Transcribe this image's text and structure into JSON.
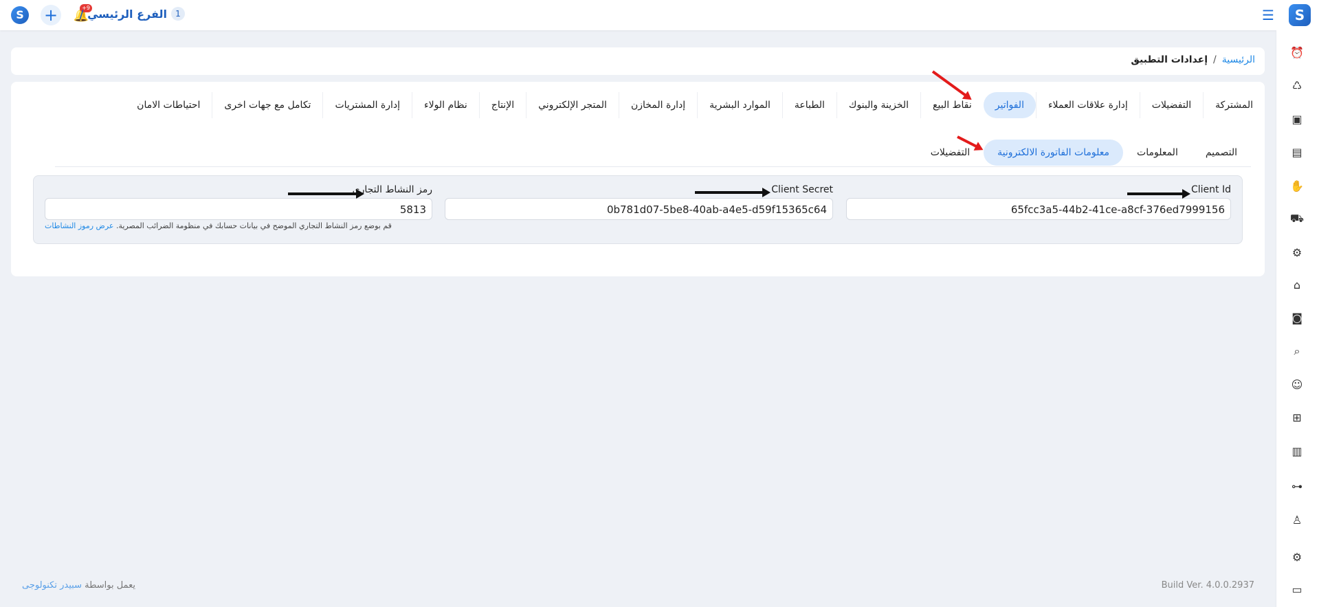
{
  "header": {
    "branch_name": "الفرع الرئيسي /",
    "branch_number": "1",
    "notifications_badge": "+9"
  },
  "breadcrumb": {
    "home": "الرئيسية",
    "separator": "/",
    "current": "إعدادات التطبيق"
  },
  "tabs": [
    {
      "label": "المشتركة"
    },
    {
      "label": "التفضيلات"
    },
    {
      "label": "إدارة علاقات العملاء"
    },
    {
      "label": "الفواتير"
    },
    {
      "label": "نقاط البيع"
    },
    {
      "label": "الخزينة والبنوك"
    },
    {
      "label": "الطباعة"
    },
    {
      "label": "الموارد البشرية"
    },
    {
      "label": "إدارة المخازن"
    },
    {
      "label": "المتجر الإلكتروني"
    },
    {
      "label": "الإنتاج"
    },
    {
      "label": "نظام الولاء"
    },
    {
      "label": "إدارة المشتريات"
    },
    {
      "label": "تكامل مع جهات اخرى"
    },
    {
      "label": "احتياطات الامان"
    }
  ],
  "subtabs": [
    {
      "label": "التصميم"
    },
    {
      "label": "المعلومات"
    },
    {
      "label": "معلومات الفاتورة الالكترونية"
    },
    {
      "label": "التفضيلات"
    }
  ],
  "form": {
    "client_id": {
      "label": "Client Id",
      "value": "65fcc3a5-44b2-41ce-a8cf-376ed7999156"
    },
    "client_secret": {
      "label": "Client Secret",
      "value": "0b781d07-5be8-40ab-a4e5-d59f15365c64"
    },
    "activity_code": {
      "label": "رمز النشاط التجارى",
      "value": "5813",
      "hint": "قم بوضع رمز النشاط التجاري الموضح في بيانات حسابك في منظومة الضرائب المصرية.",
      "hint_link": "عرض رموز النشاطات"
    }
  },
  "footer": {
    "powered_prefix": "يعمل بواسطة",
    "powered_brand": "سبيدر تكنولوجى",
    "build": "Build Ver. 4.0.0.2937"
  },
  "colors": {
    "accent": "#1e6fd9",
    "active_tab_bg": "#dbeafc",
    "annotation_red": "#e31b1b"
  }
}
